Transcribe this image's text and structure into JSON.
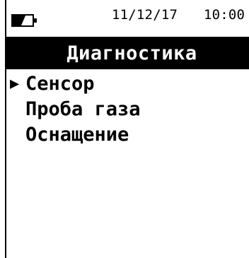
{
  "status_bar": {
    "battery_icon": "battery-icon",
    "date": "11/12/17",
    "time": "10:00"
  },
  "title": "Диагностика",
  "menu": {
    "cursor_glyph": "▶",
    "selected_index": 0,
    "items": [
      {
        "label": "Сенсор"
      },
      {
        "label": "Проба газа"
      },
      {
        "label": "Оснащение"
      }
    ]
  },
  "colors": {
    "foreground": "#000000",
    "background": "#ffffff",
    "title_text": "#ffffff"
  }
}
